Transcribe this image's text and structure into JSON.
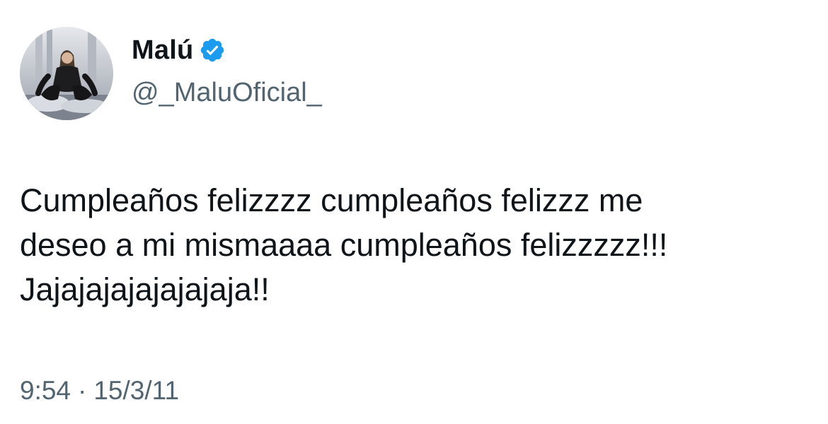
{
  "author": {
    "display_name": "Malú",
    "handle": "@_MaluOficial_",
    "verified": true,
    "verified_icon": "verified-badge-icon",
    "verified_color": "#1d9bf0"
  },
  "tweet": {
    "lines": [
      "Cumpleaños felizzzz cumpleaños felizzz me",
      "deseo a mi mismaaaa cumpleaños felizzzzz!!!",
      "Jajajajajajajajaja!!"
    ]
  },
  "meta": {
    "time": "9:54",
    "separator": "·",
    "date": "15/3/11"
  },
  "colors": {
    "text": "#0f1419",
    "secondary": "#536471",
    "background": "#ffffff"
  }
}
